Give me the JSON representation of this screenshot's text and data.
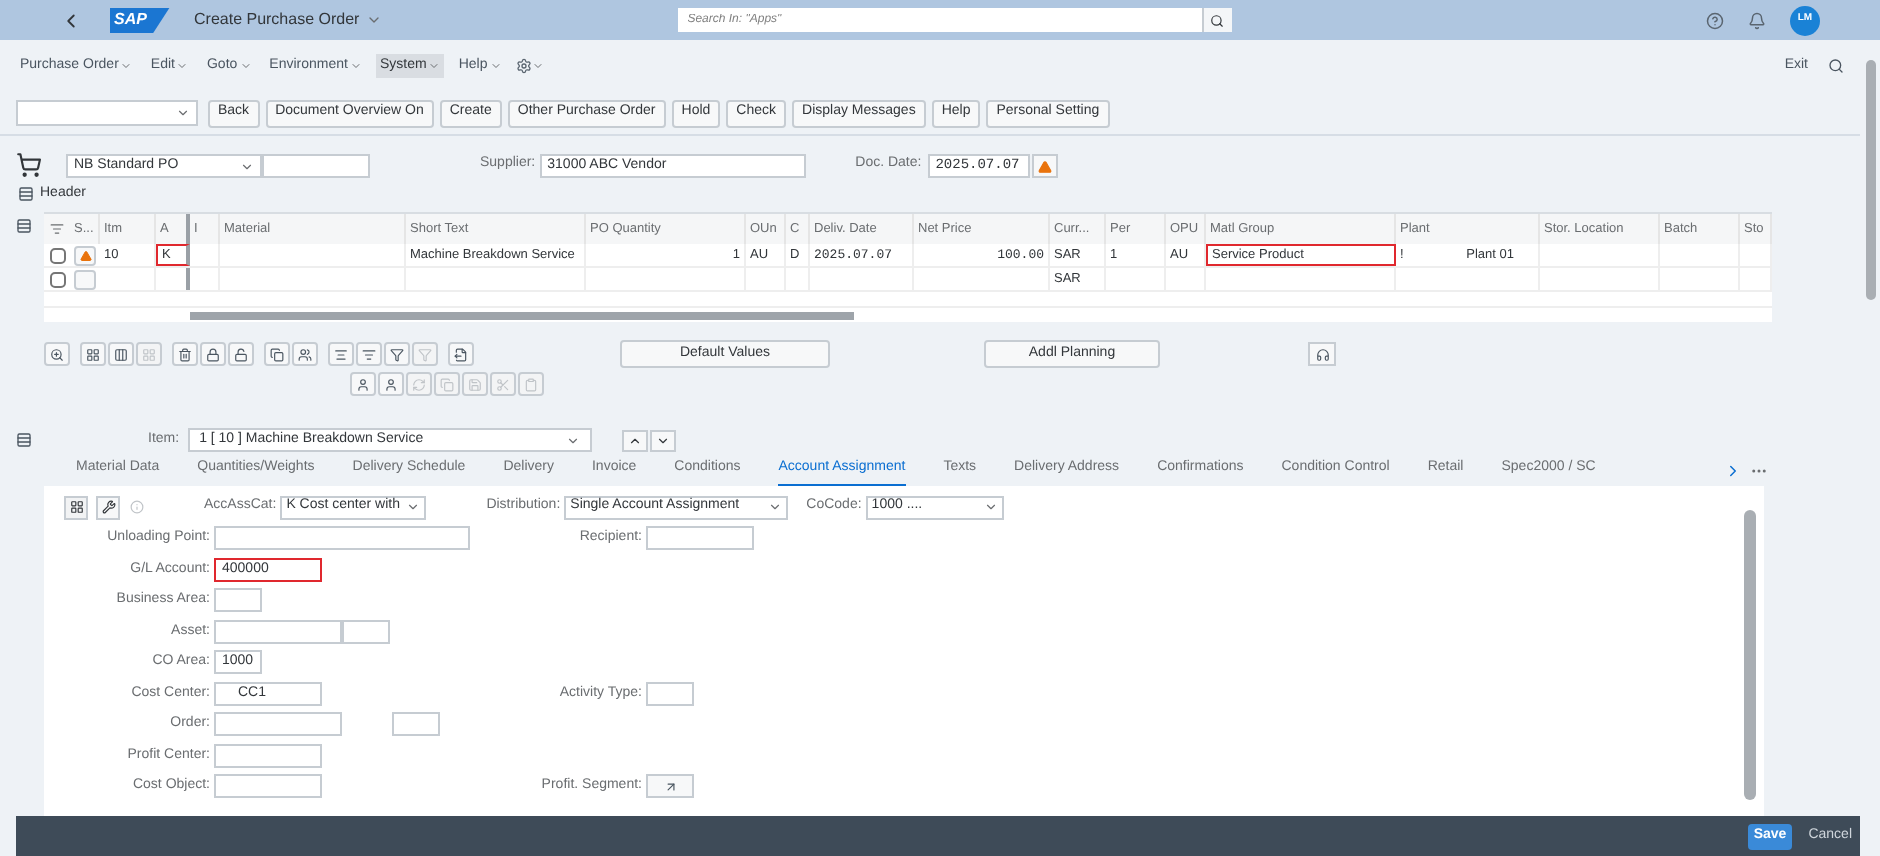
{
  "shell": {
    "logo": "SAP",
    "title": "Create Purchase Order",
    "search_placeholder": "Search In: \"Apps\"",
    "avatar": "LM"
  },
  "menu": [
    {
      "label": "Purchase Order",
      "selected": false
    },
    {
      "label": "Edit",
      "selected": false
    },
    {
      "label": "Goto",
      "selected": false
    },
    {
      "label": "Environment",
      "selected": false
    },
    {
      "label": "System",
      "selected": true
    },
    {
      "label": "Help",
      "selected": false
    }
  ],
  "exit": "Exit",
  "toolbar": [
    "Back",
    "Document Overview On",
    "Create",
    "Other Purchase Order",
    "Hold",
    "Check",
    "Display Messages",
    "Help",
    "Personal Setting"
  ],
  "header": {
    "doc_type": "NB Standard PO",
    "supplier_label": "Supplier:",
    "supplier": "31000 ABC Vendor",
    "doc_date_label": "Doc. Date:",
    "doc_date": "2025.07.07",
    "header_label": "Header"
  },
  "table": {
    "columns": [
      "S...",
      "Itm",
      "A",
      "I",
      "Material",
      "Short Text",
      "PO Quantity",
      "OUn",
      "C",
      "Deliv. Date",
      "Net Price",
      "Curr...",
      "Per",
      "OPU",
      "Matl Group",
      "Plant",
      "Stor. Location",
      "Batch",
      "Sto"
    ],
    "rows": [
      {
        "checked": false,
        "cells": [
          {
            "warning": true
          },
          {
            "text": "10"
          },
          {
            "text": "K",
            "highlighted": true
          },
          {},
          {},
          {
            "text": "Machine Breakdown Service"
          },
          {
            "text": "1"
          },
          {
            "text": "AU"
          },
          {
            "text": "D"
          },
          {
            "text": "2025.07.07"
          },
          {
            "text": "100.00"
          },
          {
            "text": "SAR"
          },
          {
            "text": "1"
          },
          {
            "text": "AU"
          },
          {
            "text": "Service Product",
            "highlighted": true
          },
          {
            "text": "!",
            "extra": "Plant 01"
          },
          {},
          {},
          {}
        ]
      },
      {
        "checked": false,
        "cells": [
          {
            "warning": false
          },
          {},
          {},
          {},
          {},
          {},
          {},
          {},
          {},
          {},
          {},
          {
            "text": "SAR"
          },
          {},
          {},
          {},
          {},
          {},
          {},
          {}
        ]
      }
    ]
  },
  "table_tools": {
    "row_1": [
      [
        {
          "disabled": false
        }
      ],
      [
        {
          "disabled": false
        },
        {
          "disabled": false
        },
        {
          "disabled": true
        }
      ],
      [
        {
          "disabled": false
        },
        {
          "disabled": false
        },
        {
          "disabled": false
        }
      ],
      [
        {
          "disabled": false
        },
        {
          "disabled": false
        }
      ],
      [
        {
          "disabled": false
        },
        {
          "disabled": false
        },
        {
          "disabled": false
        },
        {
          "disabled": true
        }
      ],
      [
        {
          "disabled": false
        }
      ]
    ],
    "row_2": [
      {
        "disabled": false
      },
      {
        "disabled": false
      },
      {
        "disabled": true
      },
      {
        "disabled": true
      },
      {
        "disabled": true
      },
      {
        "disabled": true
      },
      {
        "disabled": true
      }
    ],
    "buttons": [
      "Default Values",
      "Addl Planning"
    ]
  },
  "item": {
    "label": "Item:",
    "value": "1 [ 10 ] Machine Breakdown Service"
  },
  "tabs": [
    {
      "label": "Material Data",
      "selected": false
    },
    {
      "label": "Quantities/Weights",
      "selected": false
    },
    {
      "label": "Delivery Schedule",
      "selected": false
    },
    {
      "label": "Delivery",
      "selected": false
    },
    {
      "label": "Invoice",
      "selected": false
    },
    {
      "label": "Conditions",
      "selected": false
    },
    {
      "label": "Account Assignment",
      "selected": true
    },
    {
      "label": "Texts",
      "selected": false
    },
    {
      "label": "Delivery Address",
      "selected": false
    },
    {
      "label": "Confirmations",
      "selected": false
    },
    {
      "label": "Condition Control",
      "selected": false
    },
    {
      "label": "Retail",
      "selected": false
    },
    {
      "label": "Spec2000 / SC",
      "selected": false
    }
  ],
  "account": {
    "acc_cat_label": "AccAssCat:",
    "acc_cat": "K Cost center with",
    "distribution_label": "Distribution:",
    "distribution": "Single Account Assignment",
    "cocode_label": "CoCode:",
    "cocode": "1000 ....",
    "rows": [
      {
        "left": {
          "label": "Unloading Point:",
          "kind": "wide"
        },
        "right": {
          "label": "Recipient:",
          "kind": "medium"
        }
      },
      {
        "left": {
          "label": "G/L Account:",
          "value": "400000",
          "kind": "medium",
          "highlighted": true
        }
      },
      {
        "left": {
          "label": "Business Area:",
          "kind": "short"
        }
      },
      {
        "left": {
          "label": "Asset:",
          "kind": "pair"
        }
      },
      {
        "left": {
          "label": "CO Area:",
          "value": "1000",
          "kind": "readonly"
        }
      },
      {
        "left": {
          "label": "Cost Center:",
          "value": "CC1",
          "kind": "medium"
        },
        "right": {
          "label": "Activity Type:",
          "kind": "short"
        }
      },
      {
        "left": {
          "label": "Order:",
          "kind": "split"
        }
      },
      {
        "left": {
          "label": "Profit Center:",
          "kind": "medium"
        }
      },
      {
        "left": {
          "label": "Cost Object:",
          "kind": "medium"
        },
        "right": {
          "label": "Profit. Segment:",
          "kind": "button"
        }
      }
    ]
  },
  "footer": [
    "Save",
    "Cancel"
  ]
}
